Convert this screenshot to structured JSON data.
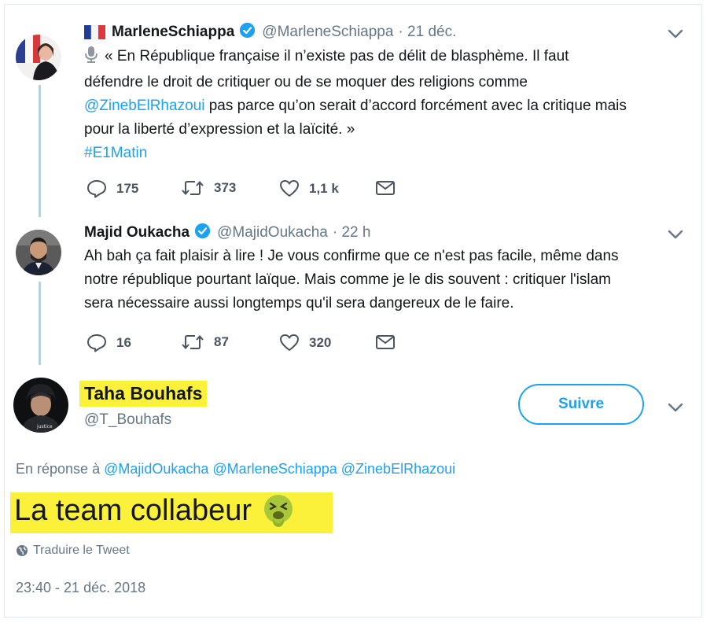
{
  "tweet1": {
    "display_name": "MarleneSchiappa",
    "handle": "@MarleneSchiappa",
    "date": "· 21 déc.",
    "line1": "« En République française il n’existe pas de délit de blasphème. Il faut",
    "line2": "défendre le droit de critiquer ou de se moquer des religions comme",
    "mention": "@ZinebElRhazoui",
    "line3_rest": " pas parce qu’on serait d’accord forcément avec la critique mais",
    "line4": "pour la liberté d’expression et la laïcité. »",
    "hashtag": "#E1Matin",
    "replies": "175",
    "retweets": "373",
    "likes": "1,1 k"
  },
  "tweet2": {
    "display_name": "Majid Oukacha",
    "handle": "@MajidOukacha",
    "date": "· 22 h",
    "line1": "Ah bah ça fait plaisir à lire ! Je vous confirme que ce n'est pas facile, même dans",
    "line2": "notre république pourtant laïque. Mais comme je le dis souvent : critiquer l'islam",
    "line3": "sera nécessaire aussi longtemps qu'il sera dangereux de le faire.",
    "replies": "16",
    "retweets": "87",
    "likes": "320"
  },
  "main_tweet": {
    "display_name": "Taha Bouhafs",
    "handle": "@T_Bouhafs",
    "follow_label": "Suivre",
    "reply_prefix": "En réponse à ",
    "reply_mentions": "@MajidOukacha @MarleneSchiappa @ZinebElRhazoui",
    "text": "La team collabeur",
    "translate": "Traduire le Tweet",
    "timestamp": "23:40 - 21 déc. 2018"
  },
  "colors": {
    "accent": "#1da1f2",
    "highlight": "#fbf03a",
    "thread_line": "#a8d5f0",
    "muted": "#657786"
  }
}
